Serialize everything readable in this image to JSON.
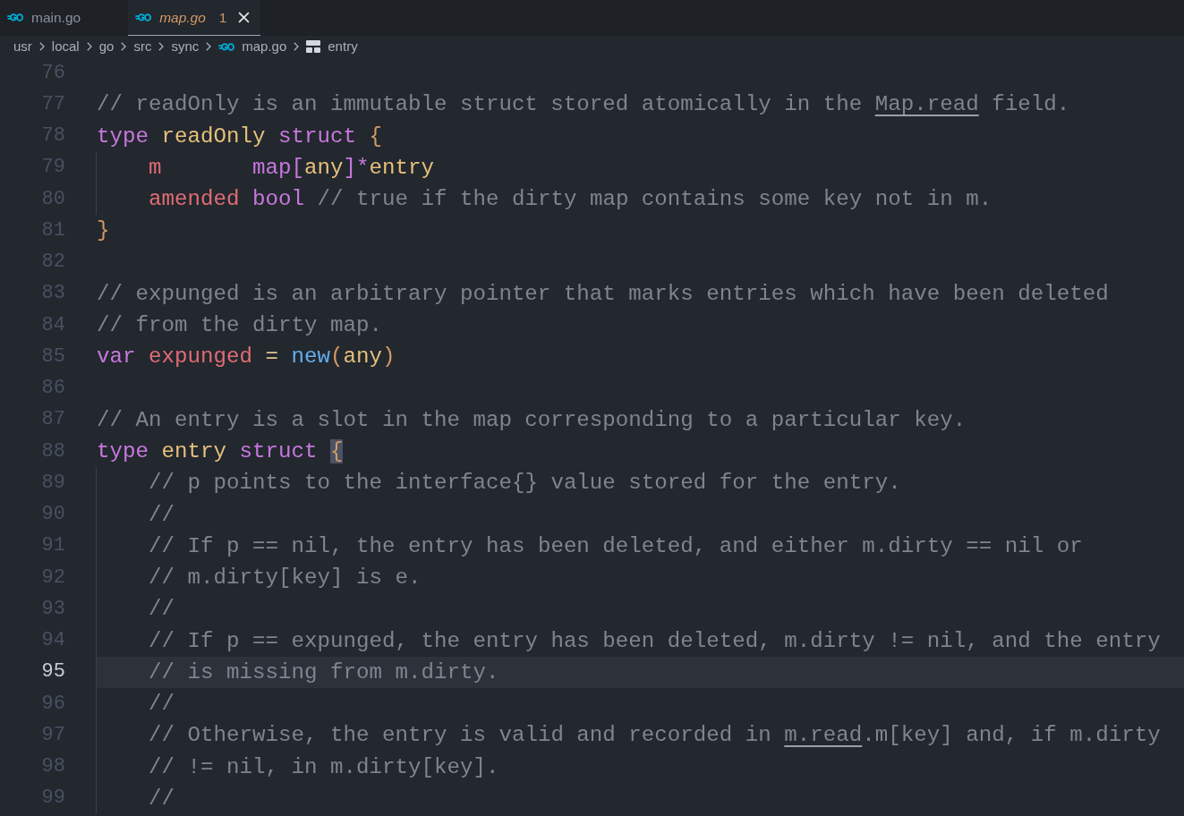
{
  "tabs": [
    {
      "label": "main.go",
      "selected": false,
      "preview": false,
      "warning": false,
      "close_button": false
    },
    {
      "label": "map.go",
      "selected": true,
      "preview": true,
      "warning": true,
      "problems": "1",
      "close_button": true
    }
  ],
  "breadcrumbs": [
    {
      "label": "usr",
      "kind": "folder"
    },
    {
      "label": "local",
      "kind": "folder"
    },
    {
      "label": "go",
      "kind": "folder"
    },
    {
      "label": "src",
      "kind": "folder"
    },
    {
      "label": "sync",
      "kind": "folder"
    },
    {
      "label": "map.go",
      "kind": "file"
    },
    {
      "label": "entry",
      "kind": "struct"
    }
  ],
  "editor": {
    "lines": [
      {
        "number": "76",
        "current": false,
        "indented": false
      },
      {
        "number": "77",
        "current": false,
        "indented": false,
        "tokens": [
          {
            "text": "// readOnly is an immutable struct stored atomically in the ",
            "kind": "comment"
          },
          {
            "text": "Map.read",
            "kind": "link"
          },
          {
            "text": " field.",
            "kind": "comment"
          }
        ]
      },
      {
        "number": "78",
        "current": false,
        "indented": false,
        "tokens": [
          {
            "text": "type ",
            "kind": "keyword"
          },
          {
            "text": "readOnly ",
            "kind": "type"
          },
          {
            "text": "struct ",
            "kind": "keyword"
          },
          {
            "text": "{",
            "kind": "brace"
          }
        ]
      },
      {
        "number": "79",
        "current": false,
        "indented": true,
        "tokens": [
          {
            "text": "m       ",
            "kind": "field"
          },
          {
            "text": "map",
            "kind": "keyword"
          },
          {
            "text": "[",
            "kind": "operator"
          },
          {
            "text": "any",
            "kind": "type"
          },
          {
            "text": "]*",
            "kind": "operator"
          },
          {
            "text": "entry",
            "kind": "type"
          }
        ]
      },
      {
        "number": "80",
        "current": false,
        "indented": true,
        "tokens": [
          {
            "text": "amended ",
            "kind": "field"
          },
          {
            "text": "bool ",
            "kind": "keyword"
          },
          {
            "text": "// true if the dirty map contains some key not in m.",
            "kind": "comment"
          }
        ]
      },
      {
        "number": "81",
        "current": false,
        "indented": false,
        "tokens": [
          {
            "text": "}",
            "kind": "brace"
          }
        ]
      },
      {
        "number": "82",
        "current": false,
        "indented": false
      },
      {
        "number": "83",
        "current": false,
        "indented": false,
        "tokens": [
          {
            "text": "// expunged is an arbitrary pointer that marks entries which have been deleted",
            "kind": "comment"
          }
        ]
      },
      {
        "number": "84",
        "current": false,
        "indented": false,
        "tokens": [
          {
            "text": "// from the dirty map.",
            "kind": "comment"
          }
        ]
      },
      {
        "number": "85",
        "current": false,
        "indented": false,
        "tokens": [
          {
            "text": "var ",
            "kind": "keyword"
          },
          {
            "text": "expunged ",
            "kind": "variable"
          },
          {
            "text": "= ",
            "kind": "assign"
          },
          {
            "text": "new",
            "kind": "function"
          },
          {
            "text": "(",
            "kind": "brace"
          },
          {
            "text": "any",
            "kind": "type"
          },
          {
            "text": ")",
            "kind": "brace"
          }
        ]
      },
      {
        "number": "86",
        "current": false,
        "indented": false
      },
      {
        "number": "87",
        "current": false,
        "indented": false,
        "tokens": [
          {
            "text": "// An entry is a slot in the map corresponding to a particular key.",
            "kind": "comment"
          }
        ]
      },
      {
        "number": "88",
        "current": false,
        "indented": false,
        "tokens": [
          {
            "text": "type ",
            "kind": "keyword"
          },
          {
            "text": "entry ",
            "kind": "type"
          },
          {
            "text": "struct ",
            "kind": "keyword"
          },
          {
            "text": "{",
            "kind": "matched-brace"
          }
        ]
      },
      {
        "number": "89",
        "current": false,
        "indented": true,
        "tokens": [
          {
            "text": "// p points to the interface{} value stored for the entry.",
            "kind": "comment"
          }
        ]
      },
      {
        "number": "90",
        "current": false,
        "indented": true,
        "tokens": [
          {
            "text": "//",
            "kind": "comment"
          }
        ]
      },
      {
        "number": "91",
        "current": false,
        "indented": true,
        "tokens": [
          {
            "text": "// If p == nil, the entry has been deleted, and either m.dirty == nil or",
            "kind": "comment"
          }
        ]
      },
      {
        "number": "92",
        "current": false,
        "indented": true,
        "tokens": [
          {
            "text": "// m.dirty[key] is e.",
            "kind": "comment"
          }
        ]
      },
      {
        "number": "93",
        "current": false,
        "indented": true,
        "tokens": [
          {
            "text": "//",
            "kind": "comment"
          }
        ]
      },
      {
        "number": "94",
        "current": false,
        "indented": true,
        "tokens": [
          {
            "text": "// If p == expunged, the entry has been deleted, m.dirty != nil, and the entry",
            "kind": "comment"
          }
        ]
      },
      {
        "number": "95",
        "current": true,
        "indented": true,
        "tokens": [
          {
            "text": "// is missing from m.dirty.",
            "kind": "comment"
          }
        ]
      },
      {
        "number": "96",
        "current": false,
        "indented": true,
        "tokens": [
          {
            "text": "//",
            "kind": "comment"
          }
        ]
      },
      {
        "number": "97",
        "current": false,
        "indented": true,
        "tokens": [
          {
            "text": "// Otherwise, the entry is valid and recorded in ",
            "kind": "comment"
          },
          {
            "text": "m.read",
            "kind": "link"
          },
          {
            "text": ".m[key] and, if m.dirty",
            "kind": "comment"
          }
        ]
      },
      {
        "number": "98",
        "current": false,
        "indented": true,
        "tokens": [
          {
            "text": "// != nil, in m.dirty[key].",
            "kind": "comment"
          }
        ]
      },
      {
        "number": "99",
        "current": false,
        "indented": true,
        "tokens": [
          {
            "text": "//",
            "kind": "comment"
          }
        ]
      }
    ]
  }
}
